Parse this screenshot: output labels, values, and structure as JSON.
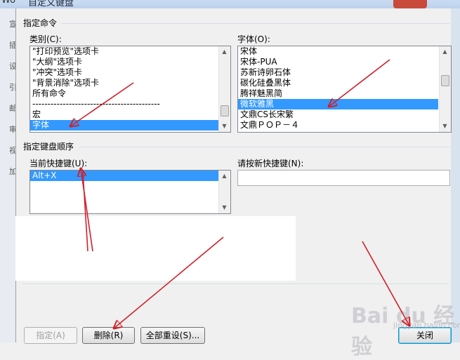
{
  "window": {
    "app_fragment": "Wo",
    "title": "自定义键盘"
  },
  "background_strip": [
    "宣",
    "插",
    "设",
    "引",
    "邮",
    "审",
    "视",
    "加"
  ],
  "specify_command": {
    "group_label": "指定命令",
    "categories_label": "类别(C):",
    "categories": [
      {
        "label": "\"打印预览\"选项卡",
        "selected": false
      },
      {
        "label": "\"大纲\"选项卡",
        "selected": false
      },
      {
        "label": "\"冲突\"选项卡",
        "selected": false
      },
      {
        "label": "\"背景消除\"选项卡",
        "selected": false
      },
      {
        "label": "所有命令",
        "selected": false
      },
      {
        "label": "------------------------------------------",
        "selected": false
      },
      {
        "label": "宏",
        "selected": false
      },
      {
        "label": "字体",
        "selected": true
      }
    ],
    "fonts_label": "字体(O):",
    "fonts": [
      {
        "label": "宋体",
        "selected": false
      },
      {
        "label": "宋体-PUA",
        "selected": false
      },
      {
        "label": "苏新诗卵石体",
        "selected": false
      },
      {
        "label": "碳化硅叠黑体",
        "selected": false
      },
      {
        "label": "腾祥魅黑简",
        "selected": false
      },
      {
        "label": "微软雅黑",
        "selected": true
      },
      {
        "label": "文鼎CS长宋繁",
        "selected": false
      },
      {
        "label": "文鼎ＰＯＰ－４",
        "selected": false
      }
    ]
  },
  "keyboard_sequence": {
    "group_label": "指定键盘顺序",
    "current_keys_label": "当前快捷键(U):",
    "current_keys": [
      {
        "label": "Alt+X",
        "selected": true
      }
    ],
    "new_key_label": "请按新快捷键(N):",
    "new_key_value": ""
  },
  "buttons": {
    "assign": "指定(A)",
    "remove": "删除(R)",
    "reset_all": "全部重设(S)...",
    "close": "关闭"
  },
  "watermark": {
    "main": "Bai du 经验",
    "sub": "jingyan.baidu.com"
  },
  "colors": {
    "selection": "#3399ff",
    "annotation_arrow": "#d0202a"
  }
}
